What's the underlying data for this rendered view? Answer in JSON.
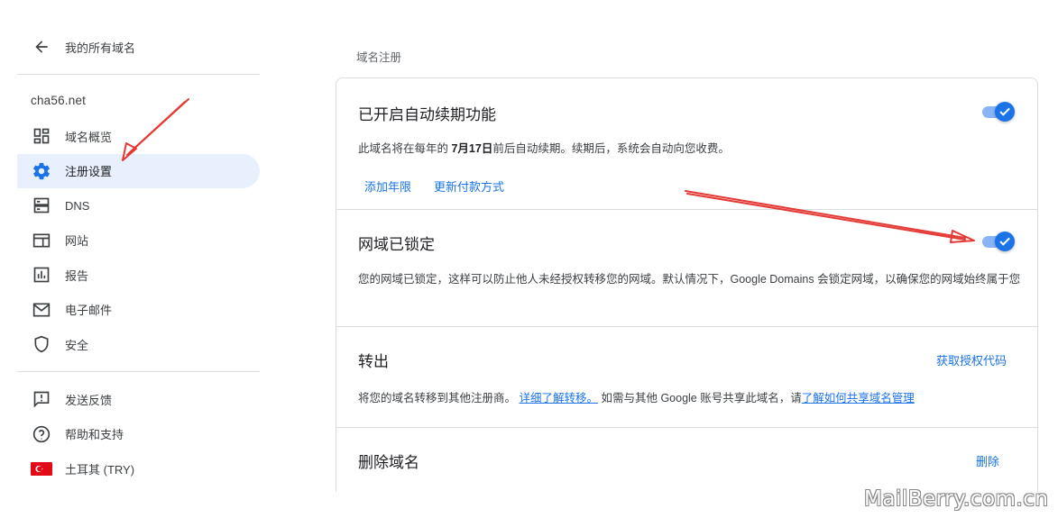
{
  "sidebar": {
    "back_label": "我的所有域名",
    "domain": "cha56.net",
    "items": [
      {
        "label": "域名概览",
        "icon": "dashboard-icon"
      },
      {
        "label": "注册设置",
        "icon": "gear-icon",
        "active": true
      },
      {
        "label": "DNS",
        "icon": "dns-icon"
      },
      {
        "label": "网站",
        "icon": "website-icon"
      },
      {
        "label": "报告",
        "icon": "report-icon"
      },
      {
        "label": "电子邮件",
        "icon": "email-icon"
      },
      {
        "label": "安全",
        "icon": "shield-icon"
      }
    ],
    "secondary": [
      {
        "label": "发送反馈",
        "icon": "feedback-icon"
      },
      {
        "label": "帮助和支持",
        "icon": "help-icon"
      },
      {
        "label": "土耳其 (TRY)",
        "icon": "turkey-flag-icon"
      }
    ]
  },
  "main": {
    "section_title": "域名注册",
    "auto_renew": {
      "title": "已开启自动续期功能",
      "desc_prefix": "此域名将在每年的 ",
      "desc_date": "7月17日",
      "desc_suffix": "前后自动续期。续期后，系统会自动向您收费。",
      "add_years": "添加年限",
      "update_payment": "更新付款方式",
      "enabled": true
    },
    "lock": {
      "title": "网域已锁定",
      "desc": "您的网域已锁定，这样可以防止他人未经授权转移您的网域。默认情况下，Google Domains 会锁定网域，以确保您的网域始终属于您",
      "enabled": true
    },
    "transfer": {
      "title": "转出",
      "get_code": "获取授权代码",
      "desc_prefix": "将您的域名转移到其他注册商。 ",
      "learn_transfer": "详细了解转移。",
      "desc_middle": " 如需与其他 Google 账号共享此域名，请",
      "learn_share": "了解如何共享域名管理"
    },
    "delete": {
      "title": "删除域名",
      "action": "删除"
    }
  },
  "watermark": "MailBerry.com.cn",
  "colors": {
    "accent": "#1a73e8",
    "active_bg": "#e8f0fe",
    "annotation": "#e53935"
  }
}
